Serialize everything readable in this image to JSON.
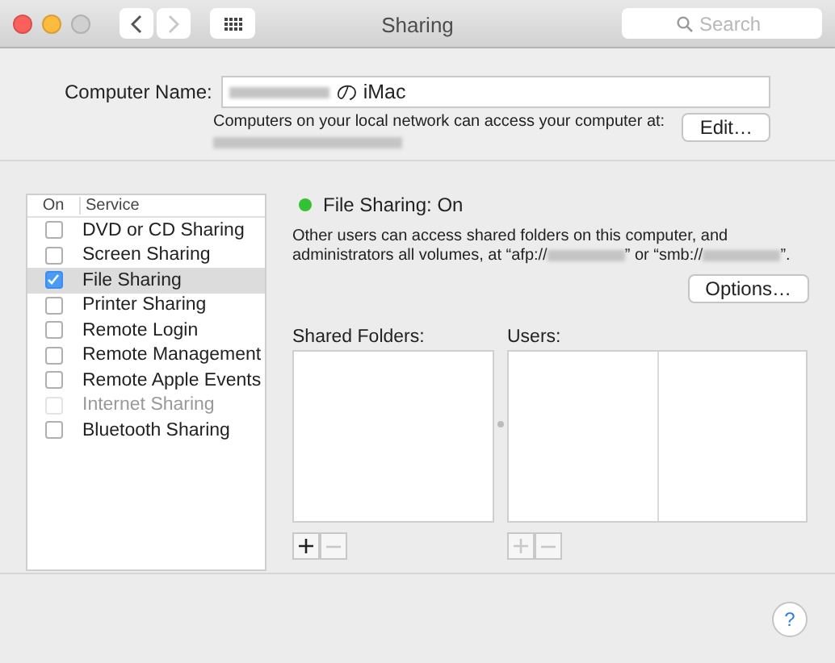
{
  "window": {
    "title": "Sharing",
    "close": true,
    "minimize": true,
    "zoom_enabled": false,
    "back_enabled": true,
    "forward_enabled": false,
    "search": {
      "placeholder": "Search"
    }
  },
  "computer_name": {
    "label": "Computer Name:",
    "value_suffix": "の iMac",
    "note": "Computers on your local network can access your computer at:",
    "edit_button": "Edit…"
  },
  "services": {
    "columns": [
      "On",
      "Service"
    ],
    "items": [
      {
        "name": "DVD or CD Sharing",
        "checked": false,
        "disabled": false,
        "selected": false
      },
      {
        "name": "Screen Sharing",
        "checked": false,
        "disabled": false,
        "selected": false
      },
      {
        "name": "File Sharing",
        "checked": true,
        "disabled": false,
        "selected": true
      },
      {
        "name": "Printer Sharing",
        "checked": false,
        "disabled": false,
        "selected": false
      },
      {
        "name": "Remote Login",
        "checked": false,
        "disabled": false,
        "selected": false
      },
      {
        "name": "Remote Management",
        "checked": false,
        "disabled": false,
        "selected": false
      },
      {
        "name": "Remote Apple Events",
        "checked": false,
        "disabled": false,
        "selected": false
      },
      {
        "name": "Internet Sharing",
        "checked": false,
        "disabled": true,
        "selected": false
      },
      {
        "name": "Bluetooth Sharing",
        "checked": false,
        "disabled": false,
        "selected": false
      }
    ]
  },
  "detail": {
    "status": "File Sharing: On",
    "status_on": true,
    "description_parts": [
      "Other users can access shared folders on this computer, and administrators all volumes, at “afp://",
      "” or “smb://",
      "”."
    ],
    "options_button": "Options…",
    "shared_folders": {
      "label": "Shared Folders:",
      "add_enabled": true,
      "remove_enabled": false
    },
    "users": {
      "label": "Users:",
      "add_enabled": false,
      "remove_enabled": false
    }
  },
  "help_button": "?"
}
